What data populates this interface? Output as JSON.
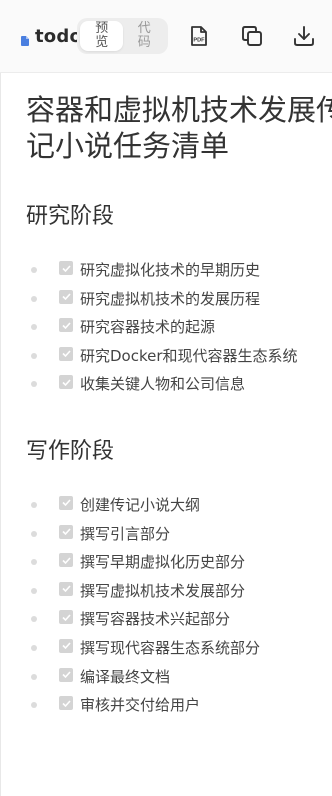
{
  "toolbar": {
    "file_name": "todo",
    "view_modes": [
      "预览",
      "代码"
    ],
    "active_view": "预览",
    "icons": [
      "pdf-export-icon",
      "copy-icon",
      "download-icon"
    ],
    "pdf_label": "PDF"
  },
  "document": {
    "title_lines": [
      "容器和虚拟机技术发展传",
      "记小说任务清单"
    ],
    "sections": [
      {
        "heading": "研究阶段",
        "tasks": [
          {
            "text": "研究虚拟化技术的早期历史",
            "checked": true
          },
          {
            "text": "研究虚拟机技术的发展历程",
            "checked": true
          },
          {
            "text": "研究容器技术的起源",
            "checked": true
          },
          {
            "text": "研究Docker和现代容器生态系统",
            "checked": true
          },
          {
            "text": "收集关键人物和公司信息",
            "checked": true
          }
        ]
      },
      {
        "heading": "写作阶段",
        "tasks": [
          {
            "text": "创建传记小说大纲",
            "checked": true
          },
          {
            "text": "撰写引言部分",
            "checked": true
          },
          {
            "text": "撰写早期虚拟化历史部分",
            "checked": true
          },
          {
            "text": "撰写虚拟机技术发展部分",
            "checked": true
          },
          {
            "text": "撰写容器技术兴起部分",
            "checked": true
          },
          {
            "text": "撰写现代容器生态系统部分",
            "checked": true
          },
          {
            "text": "编译最终文档",
            "checked": true
          },
          {
            "text": "审核并交付给用户",
            "checked": true
          }
        ]
      }
    ]
  },
  "colors": {
    "file_icon": "#4a7fe0",
    "checkbox": "#d4d4d4",
    "bullet": "#dcdcdc",
    "text": "#333333"
  }
}
